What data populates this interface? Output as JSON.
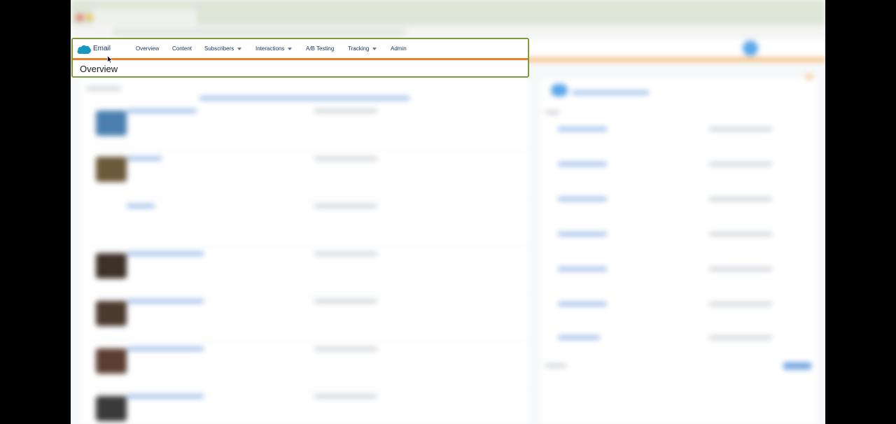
{
  "app": {
    "name": "Email",
    "page_title": "Overview"
  },
  "nav": {
    "items": [
      {
        "label": "Overview",
        "has_dropdown": false
      },
      {
        "label": "Content",
        "has_dropdown": false
      },
      {
        "label": "Subscribers",
        "has_dropdown": true
      },
      {
        "label": "Interactions",
        "has_dropdown": true
      },
      {
        "label": "A/B Testing",
        "has_dropdown": false
      },
      {
        "label": "Tracking",
        "has_dropdown": true
      },
      {
        "label": "Admin",
        "has_dropdown": false
      }
    ]
  },
  "colors": {
    "highlight_border": "#7d9d3a",
    "accent_orange": "#e8822d",
    "brand_blue": "#1798c1",
    "nav_text": "#16325c"
  },
  "icons": {
    "logo": "cloud-icon",
    "dropdown": "chevron-down-icon",
    "pointer": "mouse-cursor-icon"
  }
}
